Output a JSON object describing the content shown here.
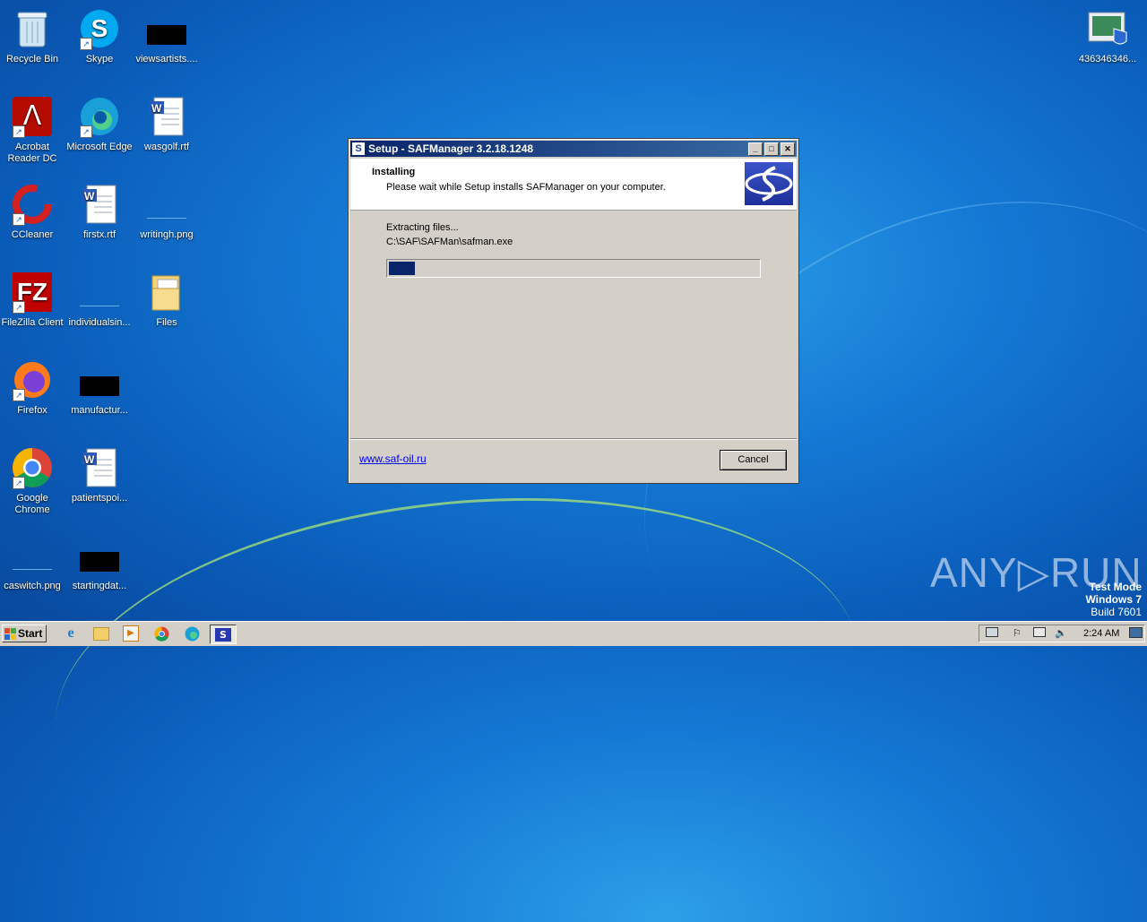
{
  "desktop": {
    "icons": [
      {
        "label": "Recycle Bin",
        "icon": "recycle-bin-icon"
      },
      {
        "label": "Skype",
        "icon": "skype-icon"
      },
      {
        "label": "viewsartists....",
        "icon": "black-file-icon"
      },
      {
        "label": "Acrobat Reader DC",
        "icon": "acrobat-icon"
      },
      {
        "label": "Microsoft Edge",
        "icon": "edge-icon"
      },
      {
        "label": "wasgolf.rtf",
        "icon": "word-doc-icon"
      },
      {
        "label": "CCleaner",
        "icon": "ccleaner-icon"
      },
      {
        "label": "firstx.rtf",
        "icon": "word-doc-icon"
      },
      {
        "label": "writingh.png",
        "icon": "png-file-icon"
      },
      {
        "label": "FileZilla Client",
        "icon": "filezilla-icon"
      },
      {
        "label": "individualsin...",
        "icon": "png-file-icon"
      },
      {
        "label": "Files",
        "icon": "folder-icon"
      },
      {
        "label": "Firefox",
        "icon": "firefox-icon"
      },
      {
        "label": "manufactur...",
        "icon": "black-file-icon"
      },
      {
        "label": "Google Chrome",
        "icon": "chrome-icon"
      },
      {
        "label": "patientspoi...",
        "icon": "word-doc-icon"
      },
      {
        "label": "caswitch.png",
        "icon": "png-file-icon"
      },
      {
        "label": "startingdat...",
        "icon": "black-file-icon"
      },
      {
        "label": "436346346...",
        "icon": "installer-file-icon"
      }
    ]
  },
  "dialog": {
    "title": "Setup - SAFManager 3.2.18.1248",
    "header_title": "Installing",
    "header_subtitle": "Please wait while Setup installs SAFManager on your computer.",
    "status_line": "Extracting files...",
    "current_file": "C:\\SAF\\SAFMan\\safman.exe",
    "progress_fraction": 0.07,
    "link_text": "www.saf-oil.ru",
    "cancel_label": "Cancel",
    "window_buttons": {
      "minimize": "_",
      "maximize": "□",
      "close": "✕"
    }
  },
  "taskbar": {
    "start_label": "Start",
    "apps": [
      "internet-explorer-icon",
      "explorer-icon",
      "media-player-icon",
      "chrome-icon",
      "edge-icon",
      "safmanager-setup-icon"
    ],
    "clock": "2:24 AM"
  },
  "watermark": {
    "text": "ANY▷RUN"
  },
  "os_badge": {
    "line1": "Test Mode",
    "line2": "Windows 7",
    "line3": "Build 7601"
  }
}
